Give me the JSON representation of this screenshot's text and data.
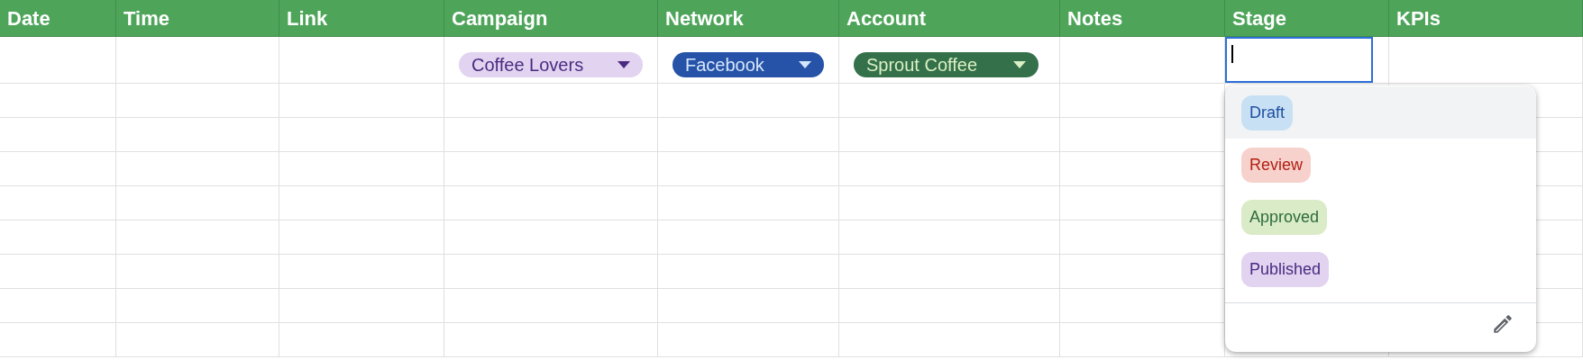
{
  "columns": [
    {
      "label": "Date"
    },
    {
      "label": "Time"
    },
    {
      "label": "Link"
    },
    {
      "label": "Campaign",
      "chip": {
        "text": "Coffee Lovers",
        "color": "#e2d3f0"
      }
    },
    {
      "label": "Network",
      "chip": {
        "text": "Facebook",
        "color": "#2653a8"
      }
    },
    {
      "label": "Account",
      "chip": {
        "text": "Sprout Coffee",
        "color": "#34704a"
      }
    },
    {
      "label": "Notes"
    },
    {
      "label": "Stage",
      "editing": true
    },
    {
      "label": "KPIs"
    }
  ],
  "dropdown": {
    "options": [
      {
        "text": "Draft",
        "color": "#c7e0f4",
        "selected": true
      },
      {
        "text": "Review",
        "color": "#f7d2cd",
        "selected": false
      },
      {
        "text": "Approved",
        "color": "#d9ebc7",
        "selected": false
      },
      {
        "text": "Published",
        "color": "#e2d3f0",
        "selected": false
      }
    ]
  }
}
